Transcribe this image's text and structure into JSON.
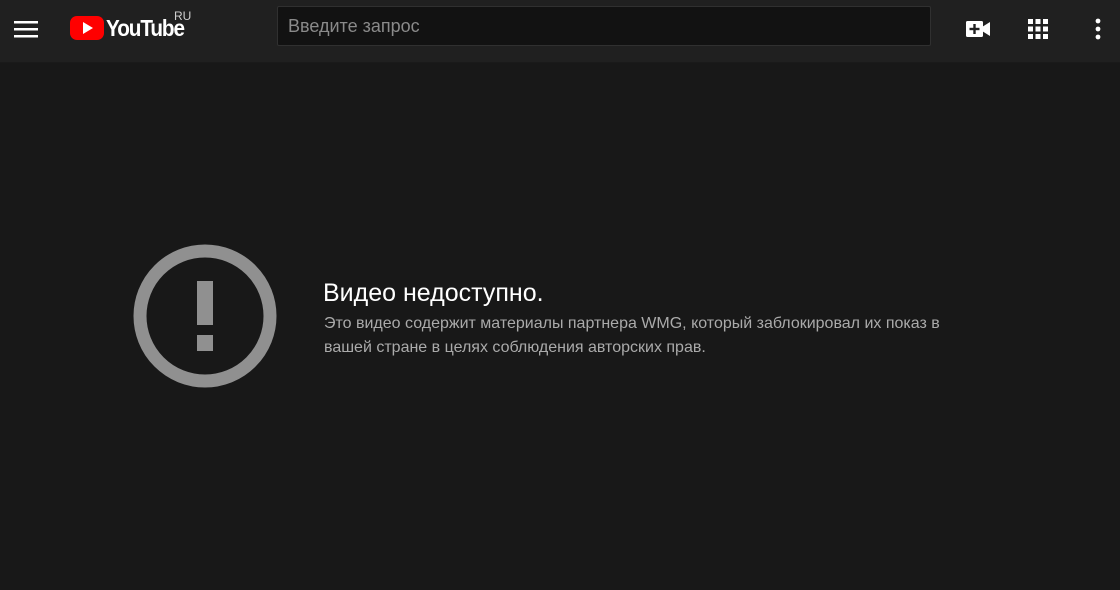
{
  "header": {
    "logo_text": "YouTube",
    "logo_region": "RU",
    "search_placeholder": "Введите запрос",
    "icons": {
      "menu": "hamburger-menu-icon",
      "create": "video-camera-plus-icon",
      "apps": "apps-grid-icon",
      "more": "more-vertical-icon"
    }
  },
  "error": {
    "icon": "exclamation-circle-icon",
    "title": "Видео недоступно.",
    "description": "Это видео содержит материалы партнера WMG, который заблокировал их показ в вашей стране в целях соблюдения авторских прав."
  },
  "colors": {
    "background": "#181818",
    "topbar": "#202020",
    "brand_red": "#ff0000",
    "icon_gray": "#909090"
  }
}
